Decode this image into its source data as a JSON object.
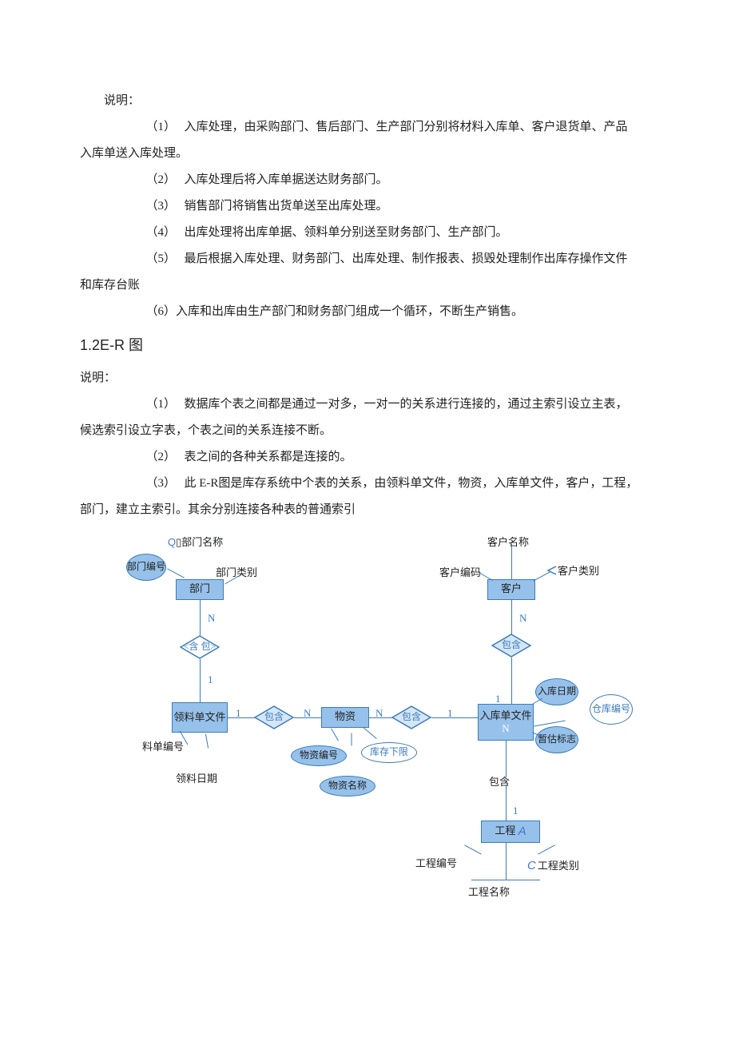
{
  "intro_label": "说明：",
  "list1": {
    "n1": "（1）",
    "t1": "入库处理，由采购部门、售后部门、生产部门分别将材料入库单、客户退货单、产品",
    "t1b": "入库单送入库处理。",
    "n2": "（2）",
    "t2": "入库处理后将入库单据送达财务部门。",
    "n3": "（3）",
    "t3": "销售部门将销售出货单送至出库处理。",
    "n4": "（4）",
    "t4": "出库处理将出库单据、领料单分别送至财务部门、生产部门。",
    "n5": "（5）",
    "t5": "最后根据入库处理、财务部门、出库处理、制作报表、损毁处理制作出库存操作文件",
    "t5b": "和库存台账",
    "n6": "（6）入库和出库由生产部门和财务部门组成一个循环，不断生产销售。"
  },
  "section": "1.2E-R 图",
  "intro2": "说明：",
  "list2": {
    "n1": "（1）",
    "t1": "数据库个表之间都是通过一对多，一对一的关系进行连接的，通过主索引设立主表，",
    "t1b": "候选索引设立字表，个表之间的关系连接不断。",
    "n2": "（2）",
    "t2": "表之间的各种关系都是连接的。",
    "n3": "（3）",
    "t3": "此 E-R图是库存系统中个表的关系，由领料单文件，物资，入库单文件，客户，工程，",
    "t3b": "部门，建立主索引。其余分别连接各种表的普通索引"
  },
  "diagram": {
    "dept_name_top": "部门名称",
    "dept_code": "部门编号",
    "dept_type": "部门类别",
    "dept": "部门",
    "cust_name_top": "客户名称",
    "cust_code": "客户编码",
    "cust_type": "客户类别",
    "cust": "客户",
    "contain": "含 包",
    "contain2": "包含",
    "contain3": "包含",
    "contain4": "包含",
    "contain5": "包含",
    "receipt": "领料单文件",
    "material": "物资",
    "inbound": "入库单文件",
    "rec_no": "料单编号",
    "rec_date": "领料日期",
    "mat_no": "物资编号",
    "mat_name": "物资名称",
    "stock_min": "库存下限",
    "in_date": "入库日期",
    "wh_no": "仓库编号",
    "tmp_flag": "暂估标志",
    "project": "工程",
    "proj_no": "工程编号",
    "proj_name": "工程名称",
    "proj_type": "工程类别",
    "N": "N",
    "one": "1",
    "A": "A",
    "C": "C",
    "Q": "Q"
  }
}
